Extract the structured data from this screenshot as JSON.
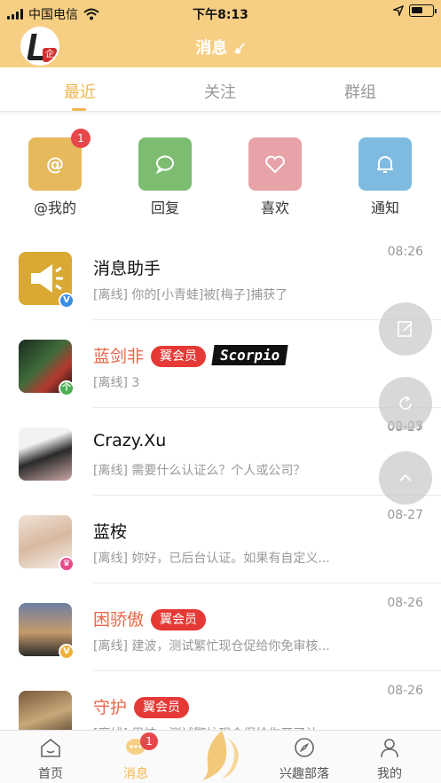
{
  "status": {
    "carrier": "中国电信",
    "time": "下午8:13"
  },
  "nav": {
    "title": "消息",
    "avatar_badge": "企"
  },
  "tabs": [
    {
      "label": "最近",
      "active": true
    },
    {
      "label": "关注",
      "active": false
    },
    {
      "label": "群组",
      "active": false
    }
  ],
  "quick_actions": [
    {
      "label": "@我的",
      "badge": "1",
      "icon": "at-icon",
      "color": "#e5b95c"
    },
    {
      "label": "回复",
      "icon": "chat-bubble-icon",
      "color": "#7dbd72"
    },
    {
      "label": "喜欢",
      "icon": "heart-icon",
      "color": "#e7a3a8"
    },
    {
      "label": "通知",
      "icon": "bell-icon",
      "color": "#7fbbe0"
    }
  ],
  "messages": [
    {
      "name": "消息助手",
      "preview": "[离线] 你的[小青蛙]被[梅子]捕获了",
      "time": "08:26",
      "vip": false,
      "badge": "V",
      "badge_color": "#3b8ee8"
    },
    {
      "name": "蓝剑非",
      "preview": "[离线] 3",
      "time": "09-05",
      "vip": true,
      "vip_label": "翼会员",
      "tag": "Scorpio",
      "badge": "个",
      "badge_color": "#4caf50"
    },
    {
      "name": "Crazy.Xu",
      "preview": "[离线] 需要什么认证么？个人或公司？",
      "time": "08-27",
      "vip": false
    },
    {
      "name": "蓝桉",
      "preview": "[离线] 妳好，已后台认证。如果有自定义...",
      "time": "08-27",
      "vip": false,
      "badge": "♛",
      "badge_color": "#e84a8b"
    },
    {
      "name": "困骄傲",
      "preview": "[离线] 建波，测试繁忙现仓促给你免审核...",
      "time": "08-26",
      "vip": true,
      "vip_label": "翼会员",
      "badge": "V",
      "badge_color": "#f2b13a"
    },
    {
      "name": "守护",
      "preview": "[离线] 男神，测试繁忙现仓促给你开了认...",
      "time": "08-26",
      "vip": true,
      "vip_label": "翼会员"
    }
  ],
  "tabbar": [
    {
      "label": "首页",
      "icon": "home-icon",
      "active": false
    },
    {
      "label": "消息",
      "icon": "message-icon",
      "active": true,
      "badge": "1"
    },
    {
      "label": "",
      "icon": "wing-logo-icon",
      "active": false
    },
    {
      "label": "兴趣部落",
      "icon": "compass-icon",
      "active": false
    },
    {
      "label": "我的",
      "icon": "person-icon",
      "active": false
    }
  ]
}
